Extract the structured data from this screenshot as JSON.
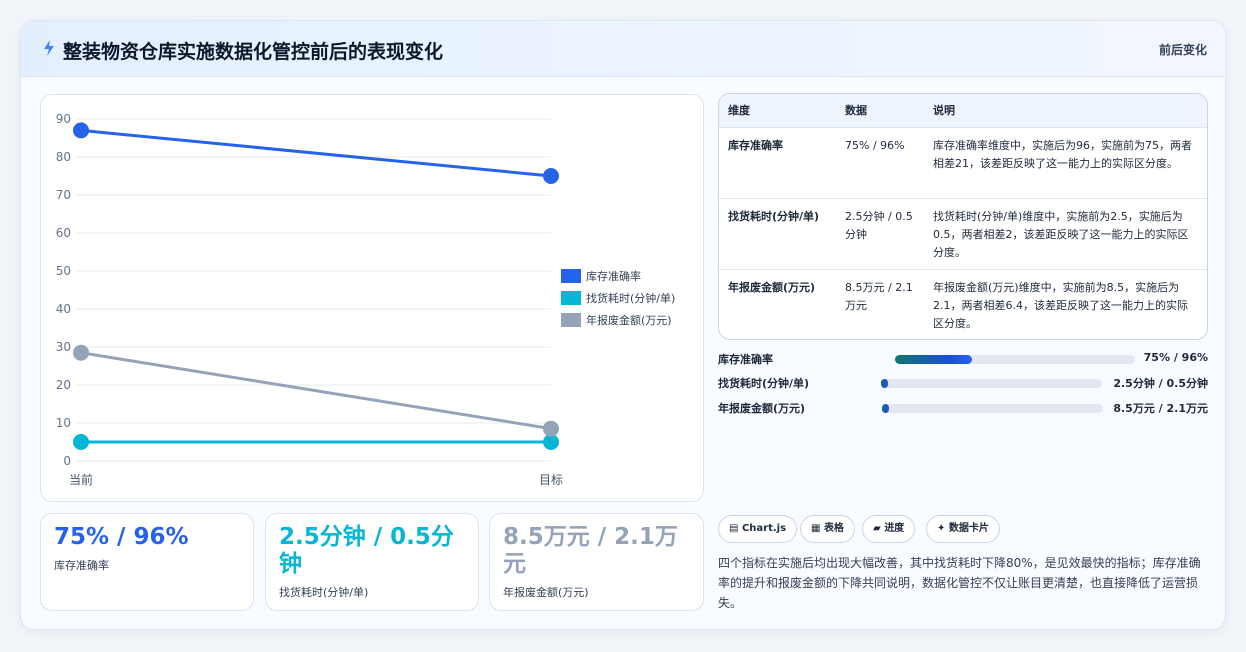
{
  "header": {
    "title": "整装物资仓库实施数据化管控前后的表现变化",
    "tag": "前后变化",
    "logo_icon": "lightning-icon"
  },
  "chart_data": {
    "type": "line",
    "categories": [
      "当前",
      "目标"
    ],
    "ylim": [
      0,
      90
    ],
    "yticks": [
      0,
      10,
      20,
      30,
      40,
      50,
      60,
      70,
      80,
      90
    ],
    "grid": true,
    "legend_position": "right",
    "series": [
      {
        "name": "库存准确率",
        "values": [
          87,
          75
        ],
        "color": "#2563eb"
      },
      {
        "name": "找货耗时(分钟/单)",
        "values": [
          5,
          5
        ],
        "color": "#06b6d4"
      },
      {
        "name": "年报废金额(万元)",
        "values": [
          28.5,
          8.5
        ],
        "color": "#94a3b8"
      }
    ]
  },
  "metric_cards": [
    {
      "value": "75% / 96%",
      "label": "库存准确率",
      "color": "#2563eb"
    },
    {
      "value": "2.5分钟 / 0.5分钟",
      "label": "找货耗时(分钟/单)",
      "color": "#06b6d4"
    },
    {
      "value": "8.5万元 / 2.1万元",
      "label": "年报废金额(万元)",
      "color": "#94a3b8"
    }
  ],
  "table": {
    "headers": [
      "维度",
      "数据",
      "说明"
    ],
    "rows": [
      {
        "dim": "库存准确率",
        "data": "75% / 96%",
        "desc": "库存准确率维度中，实施后为96，实施前为75，两者相差21，该差距反映了这一能力上的实际区分度。"
      },
      {
        "dim": "找货耗时(分钟/单)",
        "data": "2.5分钟 / 0.5分钟",
        "desc": "找货耗时(分钟/单)维度中，实施前为2.5，实施后为0.5，两者相差2，该差距反映了这一能力上的实际区分度。"
      },
      {
        "dim": "年报废金额(万元)",
        "data": "8.5万元 / 2.1万元",
        "desc": "年报废金额(万元)维度中，实施前为8.5，实施后为2.1，两者相差6.4，该差距反映了这一能力上的实际区分度。"
      }
    ]
  },
  "progress": [
    {
      "label": "库存准确率",
      "value": "75% / 96%",
      "fraction": 0.32
    },
    {
      "label": "找货耗时(分钟/单)",
      "value": "2.5分钟 / 0.5分钟",
      "fraction": 0.03
    },
    {
      "label": "年报废金额(万元)",
      "value": "8.5万元 / 2.1万元",
      "fraction": 0.03
    }
  ],
  "chips": [
    {
      "icon": "chart-icon",
      "glyph": "▤",
      "label": "Chart.js"
    },
    {
      "icon": "table-icon",
      "glyph": "▦",
      "label": "表格"
    },
    {
      "icon": "progress-icon",
      "glyph": "▰",
      "label": "进度"
    },
    {
      "icon": "sparkle-icon",
      "glyph": "✦",
      "label": "数据卡片"
    }
  ],
  "summary": "四个指标在实施后均出现大幅改善，其中找货耗时下降80%，是见效最快的指标；库存准确率的提升和报废金额的下降共同说明，数据化管控不仅让账目更清楚，也直接降低了运营损失。"
}
